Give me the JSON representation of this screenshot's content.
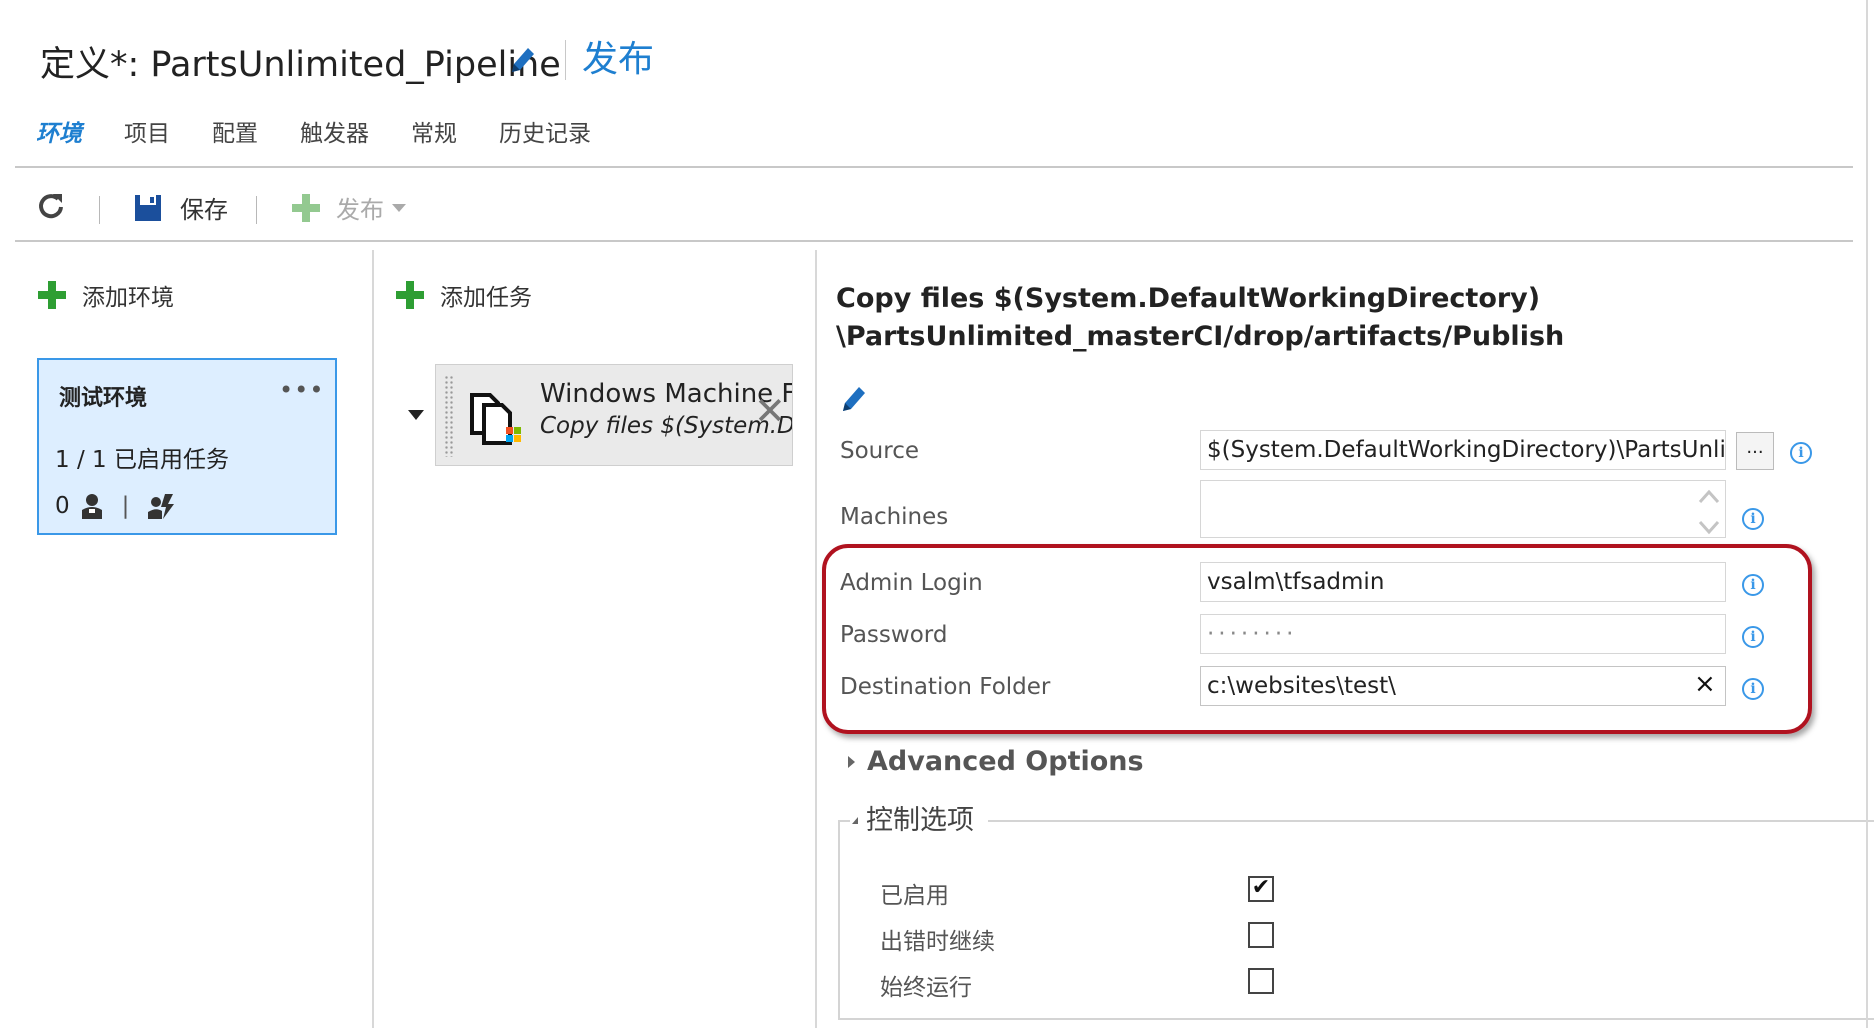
{
  "header": {
    "title": "定义*: PartsUnlimited_Pipeline",
    "release_link": "发布"
  },
  "tabs": [
    {
      "label": "环境",
      "active": true
    },
    {
      "label": "项目"
    },
    {
      "label": "配置"
    },
    {
      "label": "触发器"
    },
    {
      "label": "常规"
    },
    {
      "label": "历史记录"
    }
  ],
  "toolbar": {
    "save_label": "保存",
    "release_label": "发布"
  },
  "environments": {
    "add_label": "添加环境",
    "card": {
      "name": "测试环境",
      "more": "•••",
      "tasks_status": "1 / 1 已启用任务",
      "approvers_count": "0",
      "separator": "|"
    }
  },
  "tasks": {
    "add_label": "添加任务",
    "item": {
      "title": "Windows Machine File Copy",
      "subtitle": "Copy files $(System.DefaultWorkingDirectory)"
    }
  },
  "detail": {
    "title_line1": "Copy files $(System.DefaultWorkingDirectory)",
    "title_line2": "\\PartsUnlimited_masterCI/drop/artifacts/Publish",
    "fields": {
      "source_label": "Source",
      "source_value": "$(System.DefaultWorkingDirectory)\\PartsUnlimited_masterCI/drop/artifacts/Publish",
      "browse_label": "...",
      "machines_label": "Machines",
      "machines_value": "",
      "admin_login_label": "Admin Login",
      "admin_login_value": "vsalm\\tfsadmin",
      "password_label": "Password",
      "password_value": "········",
      "destination_label": "Destination Folder",
      "destination_value": "c:\\websites\\test\\",
      "clear_icon": "×"
    },
    "advanced_options_label": "Advanced Options",
    "control_options": {
      "label": "控制选项",
      "enabled_label": "已启用",
      "enabled": true,
      "continue_on_error_label": "出错时继续",
      "continue_on_error": false,
      "always_run_label": "始终运行",
      "always_run": false
    }
  },
  "colors": {
    "accent": "#1e7fd0",
    "highlight_border": "#b0121f",
    "env_card_bg": "#ddeeff",
    "plus_green": "#2e9e33"
  }
}
